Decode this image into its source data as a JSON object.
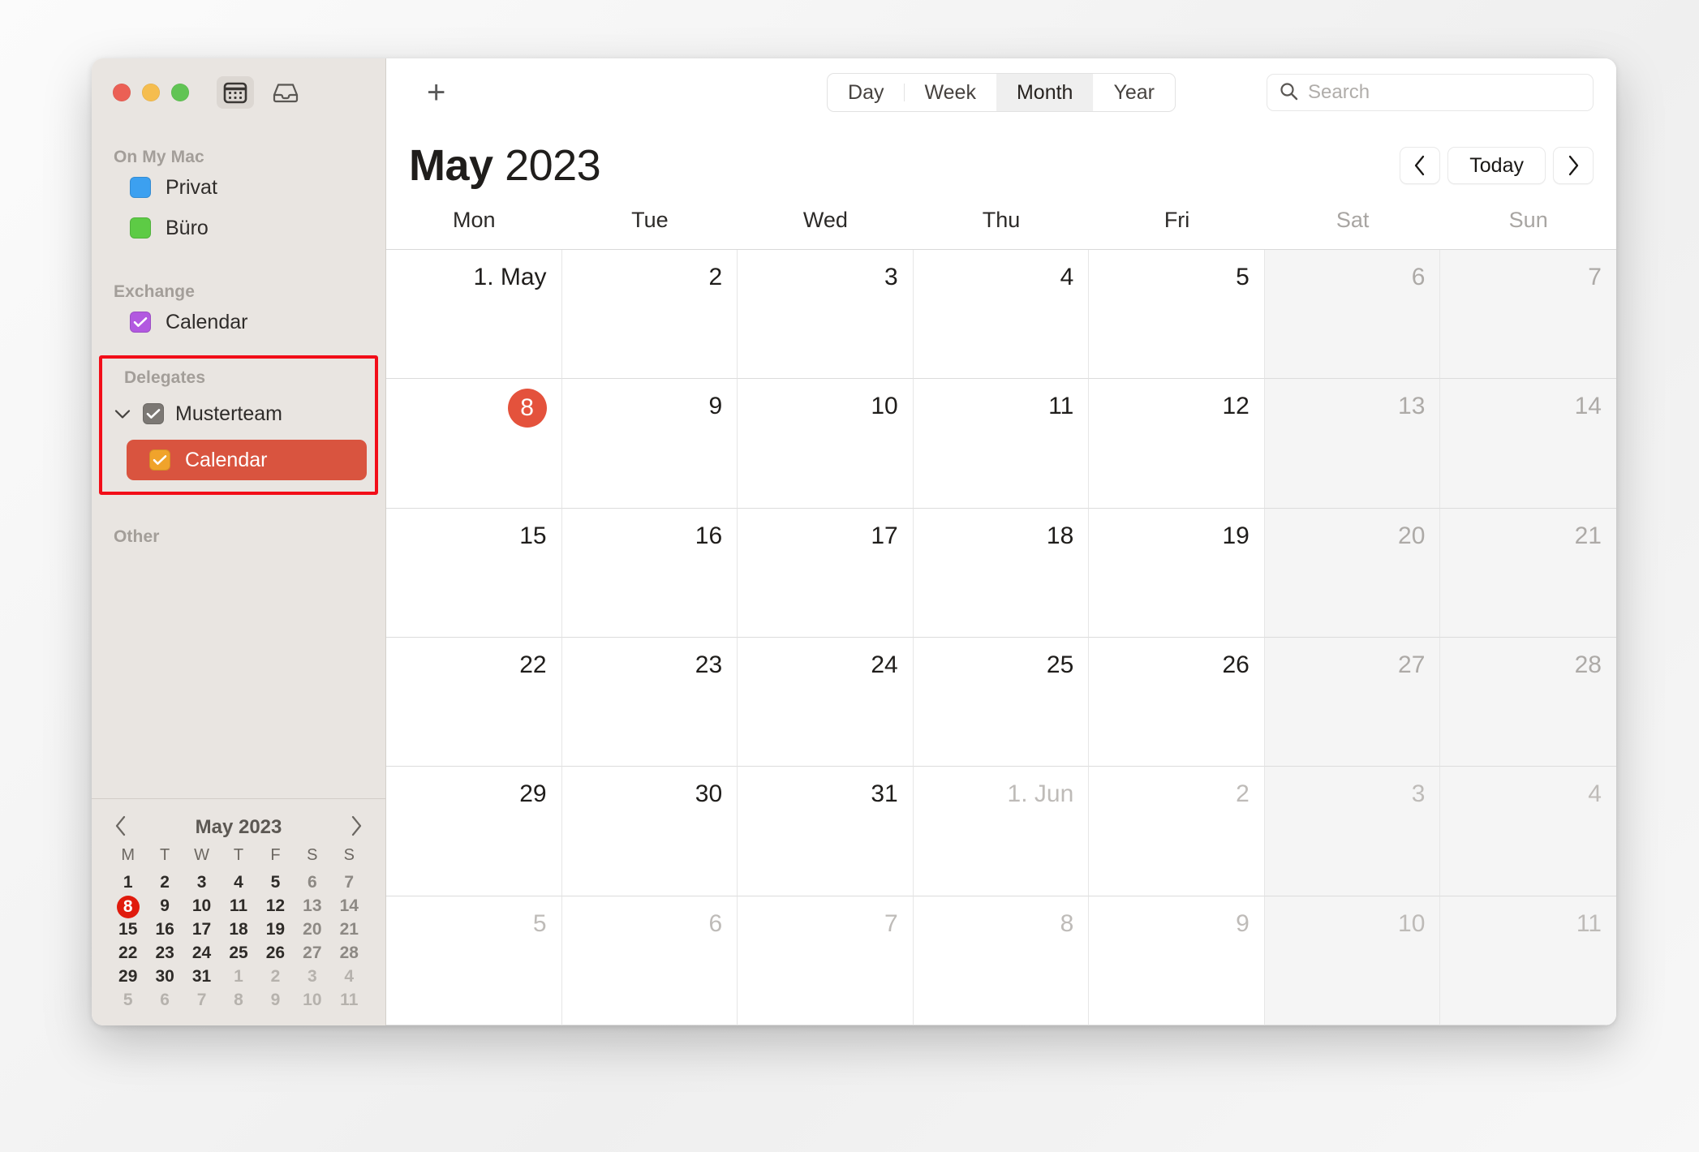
{
  "window": {
    "traffic_lights": [
      "close",
      "minimize",
      "zoom"
    ],
    "toolbar_icons": [
      {
        "name": "calendar-view-icon",
        "active": true
      },
      {
        "name": "inbox-icon",
        "active": false
      }
    ]
  },
  "sidebar": {
    "sections": [
      {
        "title": "On My Mac",
        "items": [
          {
            "label": "Privat",
            "color": "#3ca0f0",
            "checked": false
          },
          {
            "label": "Büro",
            "color": "#5dcb45",
            "checked": false
          }
        ]
      },
      {
        "title": "Exchange",
        "items": [
          {
            "label": "Calendar",
            "color": "#b259e0",
            "checked": true
          }
        ]
      }
    ],
    "delegates": {
      "title": "Delegates",
      "highlight_color": "#f20d18",
      "group": {
        "label": "Musterteam",
        "color": "#7c7874",
        "checked": true,
        "expanded": true
      },
      "child": {
        "label": "Calendar",
        "color": "#f0a32b",
        "checked": true,
        "selected": true,
        "selected_bg": "#d9543f"
      }
    },
    "other": {
      "title": "Other"
    },
    "mini_calendar": {
      "title": "May 2023",
      "prev_label": "‹",
      "next_label": "›",
      "dow": [
        "M",
        "T",
        "W",
        "T",
        "F",
        "S",
        "S"
      ],
      "weeks": [
        [
          {
            "d": "1"
          },
          {
            "d": "2"
          },
          {
            "d": "3"
          },
          {
            "d": "4"
          },
          {
            "d": "5"
          },
          {
            "d": "6",
            "we": true
          },
          {
            "d": "7",
            "we": true
          }
        ],
        [
          {
            "d": "8",
            "today": true
          },
          {
            "d": "9"
          },
          {
            "d": "10"
          },
          {
            "d": "11"
          },
          {
            "d": "12"
          },
          {
            "d": "13",
            "we": true
          },
          {
            "d": "14",
            "we": true
          }
        ],
        [
          {
            "d": "15"
          },
          {
            "d": "16"
          },
          {
            "d": "17"
          },
          {
            "d": "18"
          },
          {
            "d": "19"
          },
          {
            "d": "20",
            "we": true
          },
          {
            "d": "21",
            "we": true
          }
        ],
        [
          {
            "d": "22"
          },
          {
            "d": "23"
          },
          {
            "d": "24"
          },
          {
            "d": "25"
          },
          {
            "d": "26"
          },
          {
            "d": "27",
            "we": true
          },
          {
            "d": "28",
            "we": true
          }
        ],
        [
          {
            "d": "29"
          },
          {
            "d": "30"
          },
          {
            "d": "31"
          },
          {
            "d": "1",
            "out": true
          },
          {
            "d": "2",
            "out": true
          },
          {
            "d": "3",
            "out": true,
            "we": true
          },
          {
            "d": "4",
            "out": true,
            "we": true
          }
        ],
        [
          {
            "d": "5",
            "out": true
          },
          {
            "d": "6",
            "out": true
          },
          {
            "d": "7",
            "out": true
          },
          {
            "d": "8",
            "out": true
          },
          {
            "d": "9",
            "out": true
          },
          {
            "d": "10",
            "out": true,
            "we": true
          },
          {
            "d": "11",
            "out": true,
            "we": true
          }
        ]
      ],
      "today_color": "#e01b0d"
    }
  },
  "toolbar": {
    "add_label": "+",
    "views": [
      {
        "label": "Day",
        "active": false
      },
      {
        "label": "Week",
        "active": false
      },
      {
        "label": "Month",
        "active": true
      },
      {
        "label": "Year",
        "active": false
      }
    ],
    "search": {
      "placeholder": "Search",
      "value": ""
    }
  },
  "header": {
    "month": "May",
    "year": "2023",
    "prev_label": "‹",
    "today_label": "Today",
    "next_label": "›"
  },
  "calendar": {
    "weekday_headers": [
      {
        "label": "Mon",
        "weekend": false
      },
      {
        "label": "Tue",
        "weekend": false
      },
      {
        "label": "Wed",
        "weekend": false
      },
      {
        "label": "Thu",
        "weekend": false
      },
      {
        "label": "Fri",
        "weekend": false
      },
      {
        "label": "Sat",
        "weekend": true
      },
      {
        "label": "Sun",
        "weekend": true
      }
    ],
    "today_color": "#e4523c",
    "weeks": [
      [
        {
          "label": "1. May"
        },
        {
          "label": "2"
        },
        {
          "label": "3"
        },
        {
          "label": "4"
        },
        {
          "label": "5"
        },
        {
          "label": "6",
          "weekend": true
        },
        {
          "label": "7",
          "weekend": true
        }
      ],
      [
        {
          "label": "8",
          "today": true
        },
        {
          "label": "9"
        },
        {
          "label": "10"
        },
        {
          "label": "11"
        },
        {
          "label": "12"
        },
        {
          "label": "13",
          "weekend": true
        },
        {
          "label": "14",
          "weekend": true
        }
      ],
      [
        {
          "label": "15"
        },
        {
          "label": "16"
        },
        {
          "label": "17"
        },
        {
          "label": "18"
        },
        {
          "label": "19"
        },
        {
          "label": "20",
          "weekend": true
        },
        {
          "label": "21",
          "weekend": true
        }
      ],
      [
        {
          "label": "22"
        },
        {
          "label": "23"
        },
        {
          "label": "24"
        },
        {
          "label": "25"
        },
        {
          "label": "26"
        },
        {
          "label": "27",
          "weekend": true
        },
        {
          "label": "28",
          "weekend": true
        }
      ],
      [
        {
          "label": "29"
        },
        {
          "label": "30"
        },
        {
          "label": "31"
        },
        {
          "label": "1. Jun",
          "outside": true
        },
        {
          "label": "2",
          "outside": true
        },
        {
          "label": "3",
          "outside": true,
          "weekend": true
        },
        {
          "label": "4",
          "outside": true,
          "weekend": true
        }
      ],
      [
        {
          "label": "5",
          "outside": true
        },
        {
          "label": "6",
          "outside": true
        },
        {
          "label": "7",
          "outside": true
        },
        {
          "label": "8",
          "outside": true
        },
        {
          "label": "9",
          "outside": true
        },
        {
          "label": "10",
          "outside": true,
          "weekend": true
        },
        {
          "label": "11",
          "outside": true,
          "weekend": true
        }
      ]
    ]
  }
}
